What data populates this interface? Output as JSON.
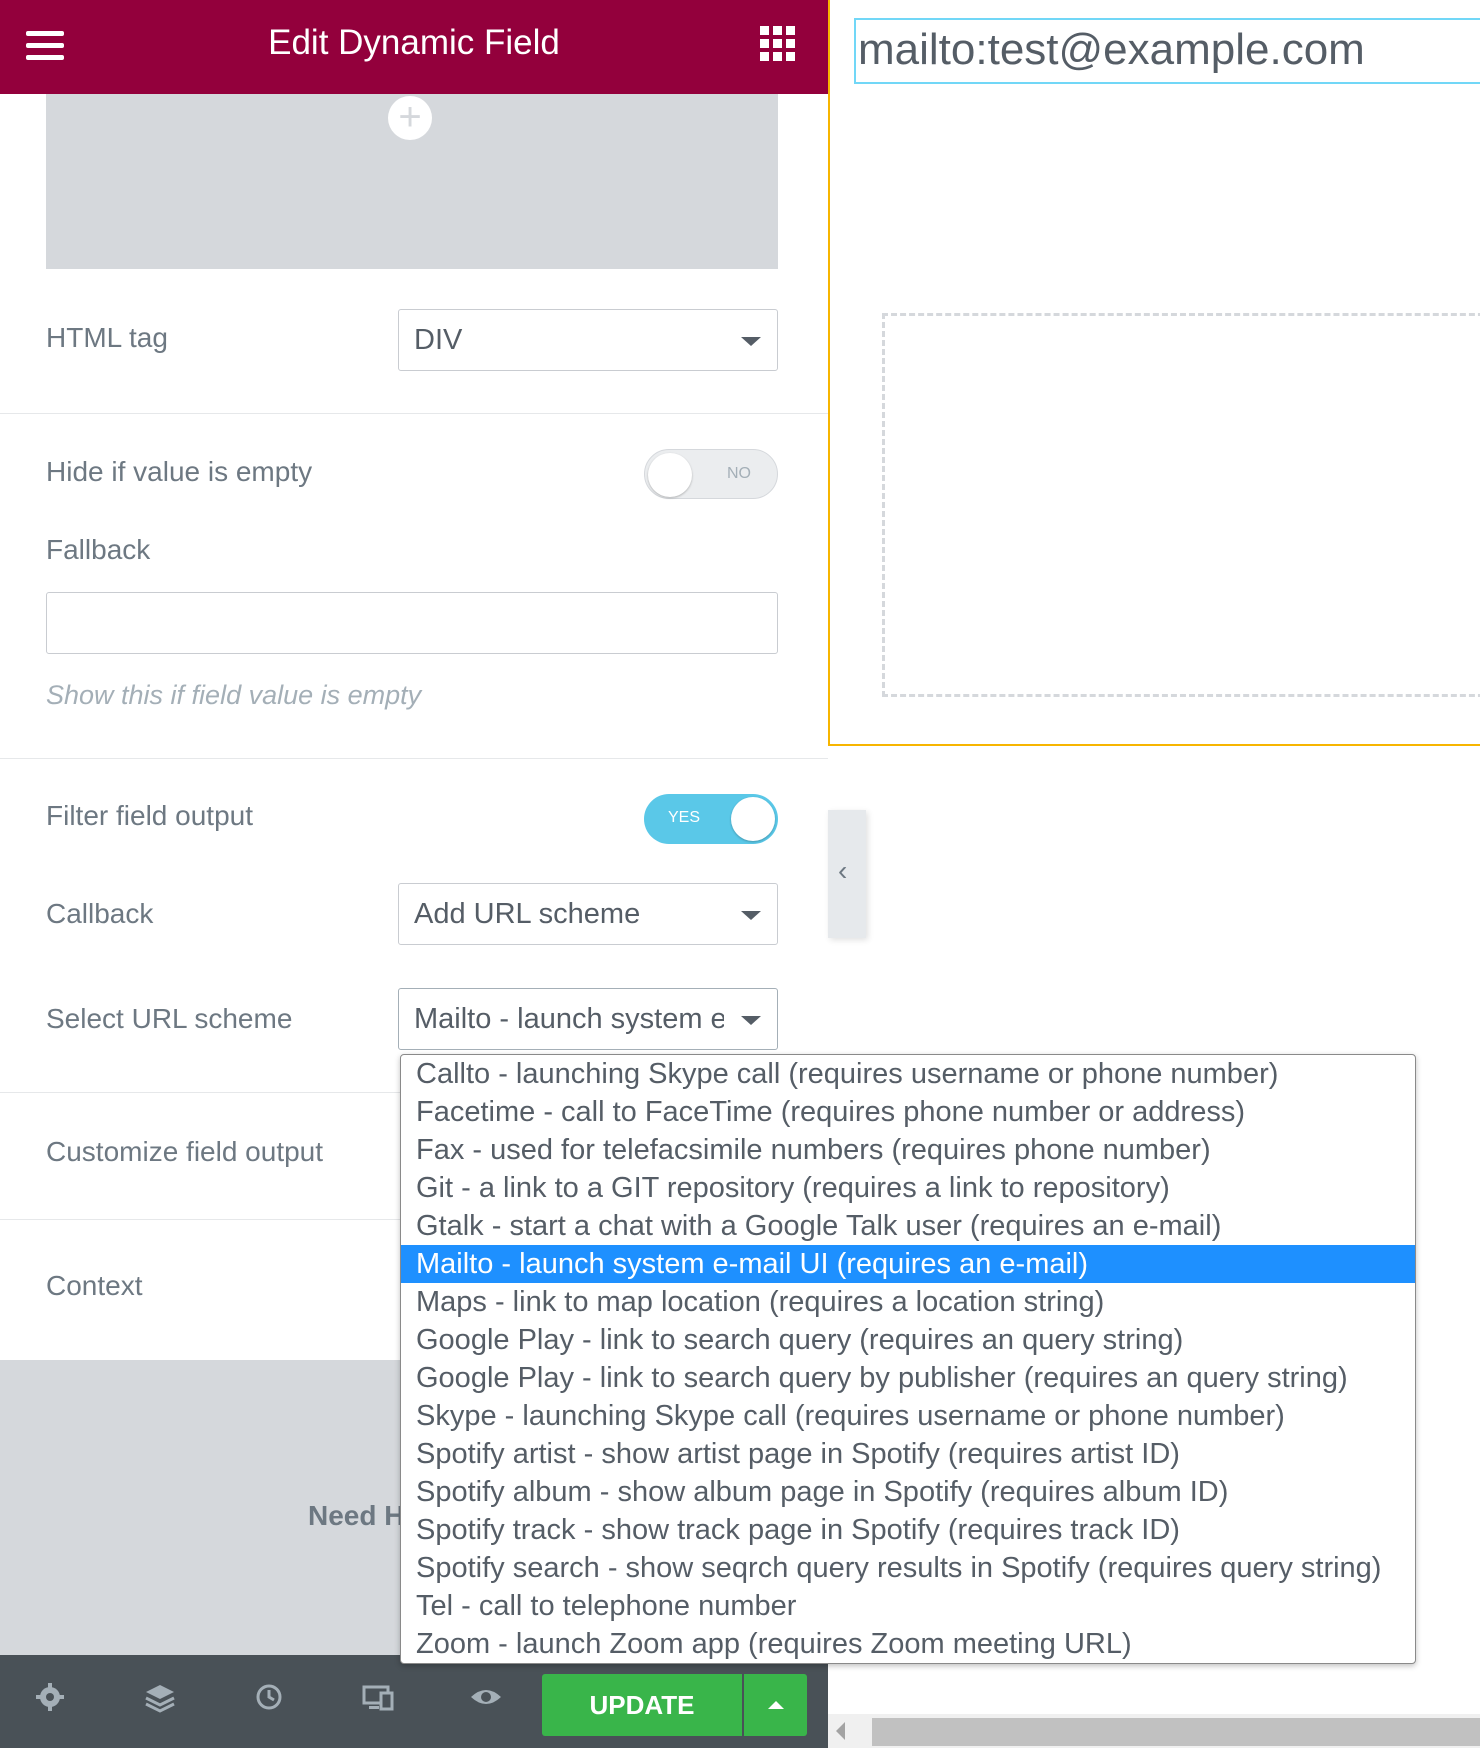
{
  "panel": {
    "title": "Edit Dynamic Field",
    "fields": {
      "html_tag": {
        "label": "HTML tag",
        "value": "DIV"
      },
      "hide_if_empty": {
        "label": "Hide if value is empty",
        "state": "NO"
      },
      "fallback": {
        "label": "Fallback",
        "value": "",
        "help": "Show this if field value is empty"
      },
      "filter_output": {
        "label": "Filter field output",
        "state": "YES"
      },
      "callback": {
        "label": "Callback",
        "value": "Add URL scheme"
      },
      "url_scheme": {
        "label": "Select URL scheme",
        "value": "Mailto - launch system e"
      },
      "customize_output": {
        "label": "Customize field output"
      },
      "context": {
        "label": "Context"
      }
    },
    "need_help": "Need H",
    "footer": {
      "update_label": "UPDATE"
    }
  },
  "preview": {
    "text": "mailto:test@example.com"
  },
  "dropdown": {
    "selected_index": 5,
    "options": [
      "Callto - launching Skype call (requires username or phone number)",
      "Facetime - call to FaceTime (requires phone number or address)",
      "Fax - used for telefacsimile numbers (requires phone number)",
      "Git - a link to a GIT repository (requires a link to repository)",
      "Gtalk - start a chat with a Google Talk user (requires an e-mail)",
      "Mailto - launch system e-mail UI (requires an e-mail)",
      "Maps - link to map location (requires a location string)",
      "Google Play - link to search query (requires an query string)",
      "Google Play - link to search query by publisher (requires an query string)",
      "Skype - launching Skype call (requires username or phone number)",
      "Spotify artist - show artist page in Spotify (requires artist ID)",
      "Spotify album - show album page in Spotify (requires album ID)",
      "Spotify track - show track page in Spotify (requires track ID)",
      "Spotify search - show seqrch query results in Spotify (requires query string)",
      "Tel - call to telephone number",
      "Zoom - launch Zoom app (requires Zoom meeting URL)"
    ]
  },
  "colors": {
    "header": "#93003c",
    "toggle_on": "#5ac8e8",
    "update_button": "#39b54a",
    "selected_option": "#1e90ff",
    "preview_border": "#f7b500"
  },
  "icons": {
    "menu": "hamburger-icon",
    "apps": "grid-icon",
    "settings": "gear-icon",
    "navigator": "layers-icon",
    "history": "history-icon",
    "responsive": "responsive-icon",
    "preview": "eye-icon"
  }
}
